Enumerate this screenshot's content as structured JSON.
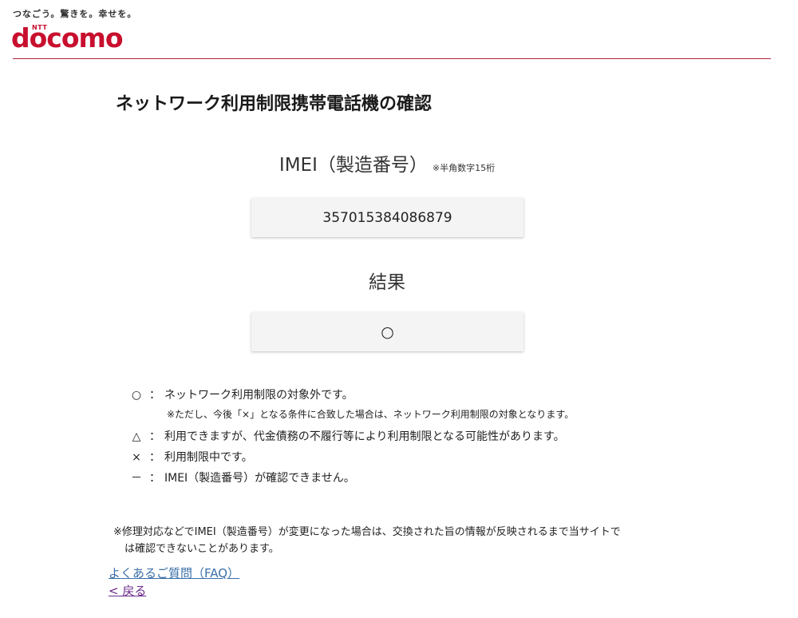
{
  "header": {
    "tagline": "つなごう。驚きを。幸せを。",
    "logo_ntt": "NTT",
    "logo_text": "docomo"
  },
  "page_title": "ネットワーク利用制限携帯電話機の確認",
  "imei": {
    "label": "IMEI（製造番号）",
    "note": "※半角数字15桁",
    "value": "357015384086879"
  },
  "result": {
    "label": "結果",
    "value": "○"
  },
  "legend": {
    "colon": "：",
    "items": [
      {
        "symbol": "○",
        "text": "ネットワーク利用制限の対象外です。"
      },
      {
        "symbol": "△",
        "text": "利用できますが、代金債務の不履行等により利用制限となる可能性があります。"
      },
      {
        "symbol": "×",
        "text": "利用制限中です。"
      },
      {
        "symbol": "－",
        "text": "IMEI（製造番号）が確認できません。"
      }
    ],
    "sub_note": "※ただし、今後「×」となる条件に合致した場合は、ネットワーク利用制限の対象となります。"
  },
  "footnote": {
    "line1": "※修理対応などでIMEI（製造番号）が変更になった場合は、交換された旨の情報が反映されるまで当サイトで",
    "line2": "は確認できないことがあります。"
  },
  "links": {
    "faq": "よくあるご質問（FAQ）",
    "back": "< 戻る"
  },
  "colors": {
    "brand": "#c8102e",
    "link": "#3b6fa8",
    "visited_link": "#6a2a8a"
  }
}
